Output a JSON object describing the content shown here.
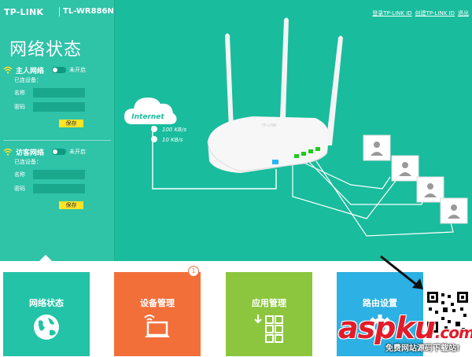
{
  "header": {
    "brand": "TP-LINK",
    "model": "TL-WR886N",
    "links": [
      "登录TP-LINK ID",
      "创建TP-LINK ID",
      "退出"
    ]
  },
  "sidebar": {
    "title": "网络状态",
    "main_network": {
      "title": "主人网络",
      "toggle_text": "未开启",
      "connected_label": "已连设备：",
      "name_label": "名称",
      "password_label": "密码",
      "name_value": "",
      "password_value": "",
      "save": "保存"
    },
    "guest_network": {
      "title": "访客网络",
      "toggle_text": "未开启",
      "connected_label": "已连设备：",
      "name_label": "名称",
      "password_label": "密码",
      "name_value": "",
      "password_value": "",
      "save": "保存"
    }
  },
  "diagram": {
    "cloud_label": "Internet",
    "upload_speed": "100 KB/s",
    "download_speed": "10 KB/s",
    "router_logo": "TP-LINK",
    "clients": 4
  },
  "tiles": [
    {
      "label": "网络状态",
      "color": "#22c3a6",
      "icon": "globe-icon"
    },
    {
      "label": "设备管理",
      "color": "#f26f3a",
      "icon": "laptop-wifi-icon",
      "badge": "1"
    },
    {
      "label": "应用管理",
      "color": "#8cc63e",
      "icon": "apps-grid-icon"
    },
    {
      "label": "路由设置",
      "color": "#2db0e3",
      "icon": "gear-icon"
    }
  ],
  "watermark": {
    "brand": "aspku",
    "tld": ".com",
    "subtitle": "免费网站源码下载站!"
  }
}
